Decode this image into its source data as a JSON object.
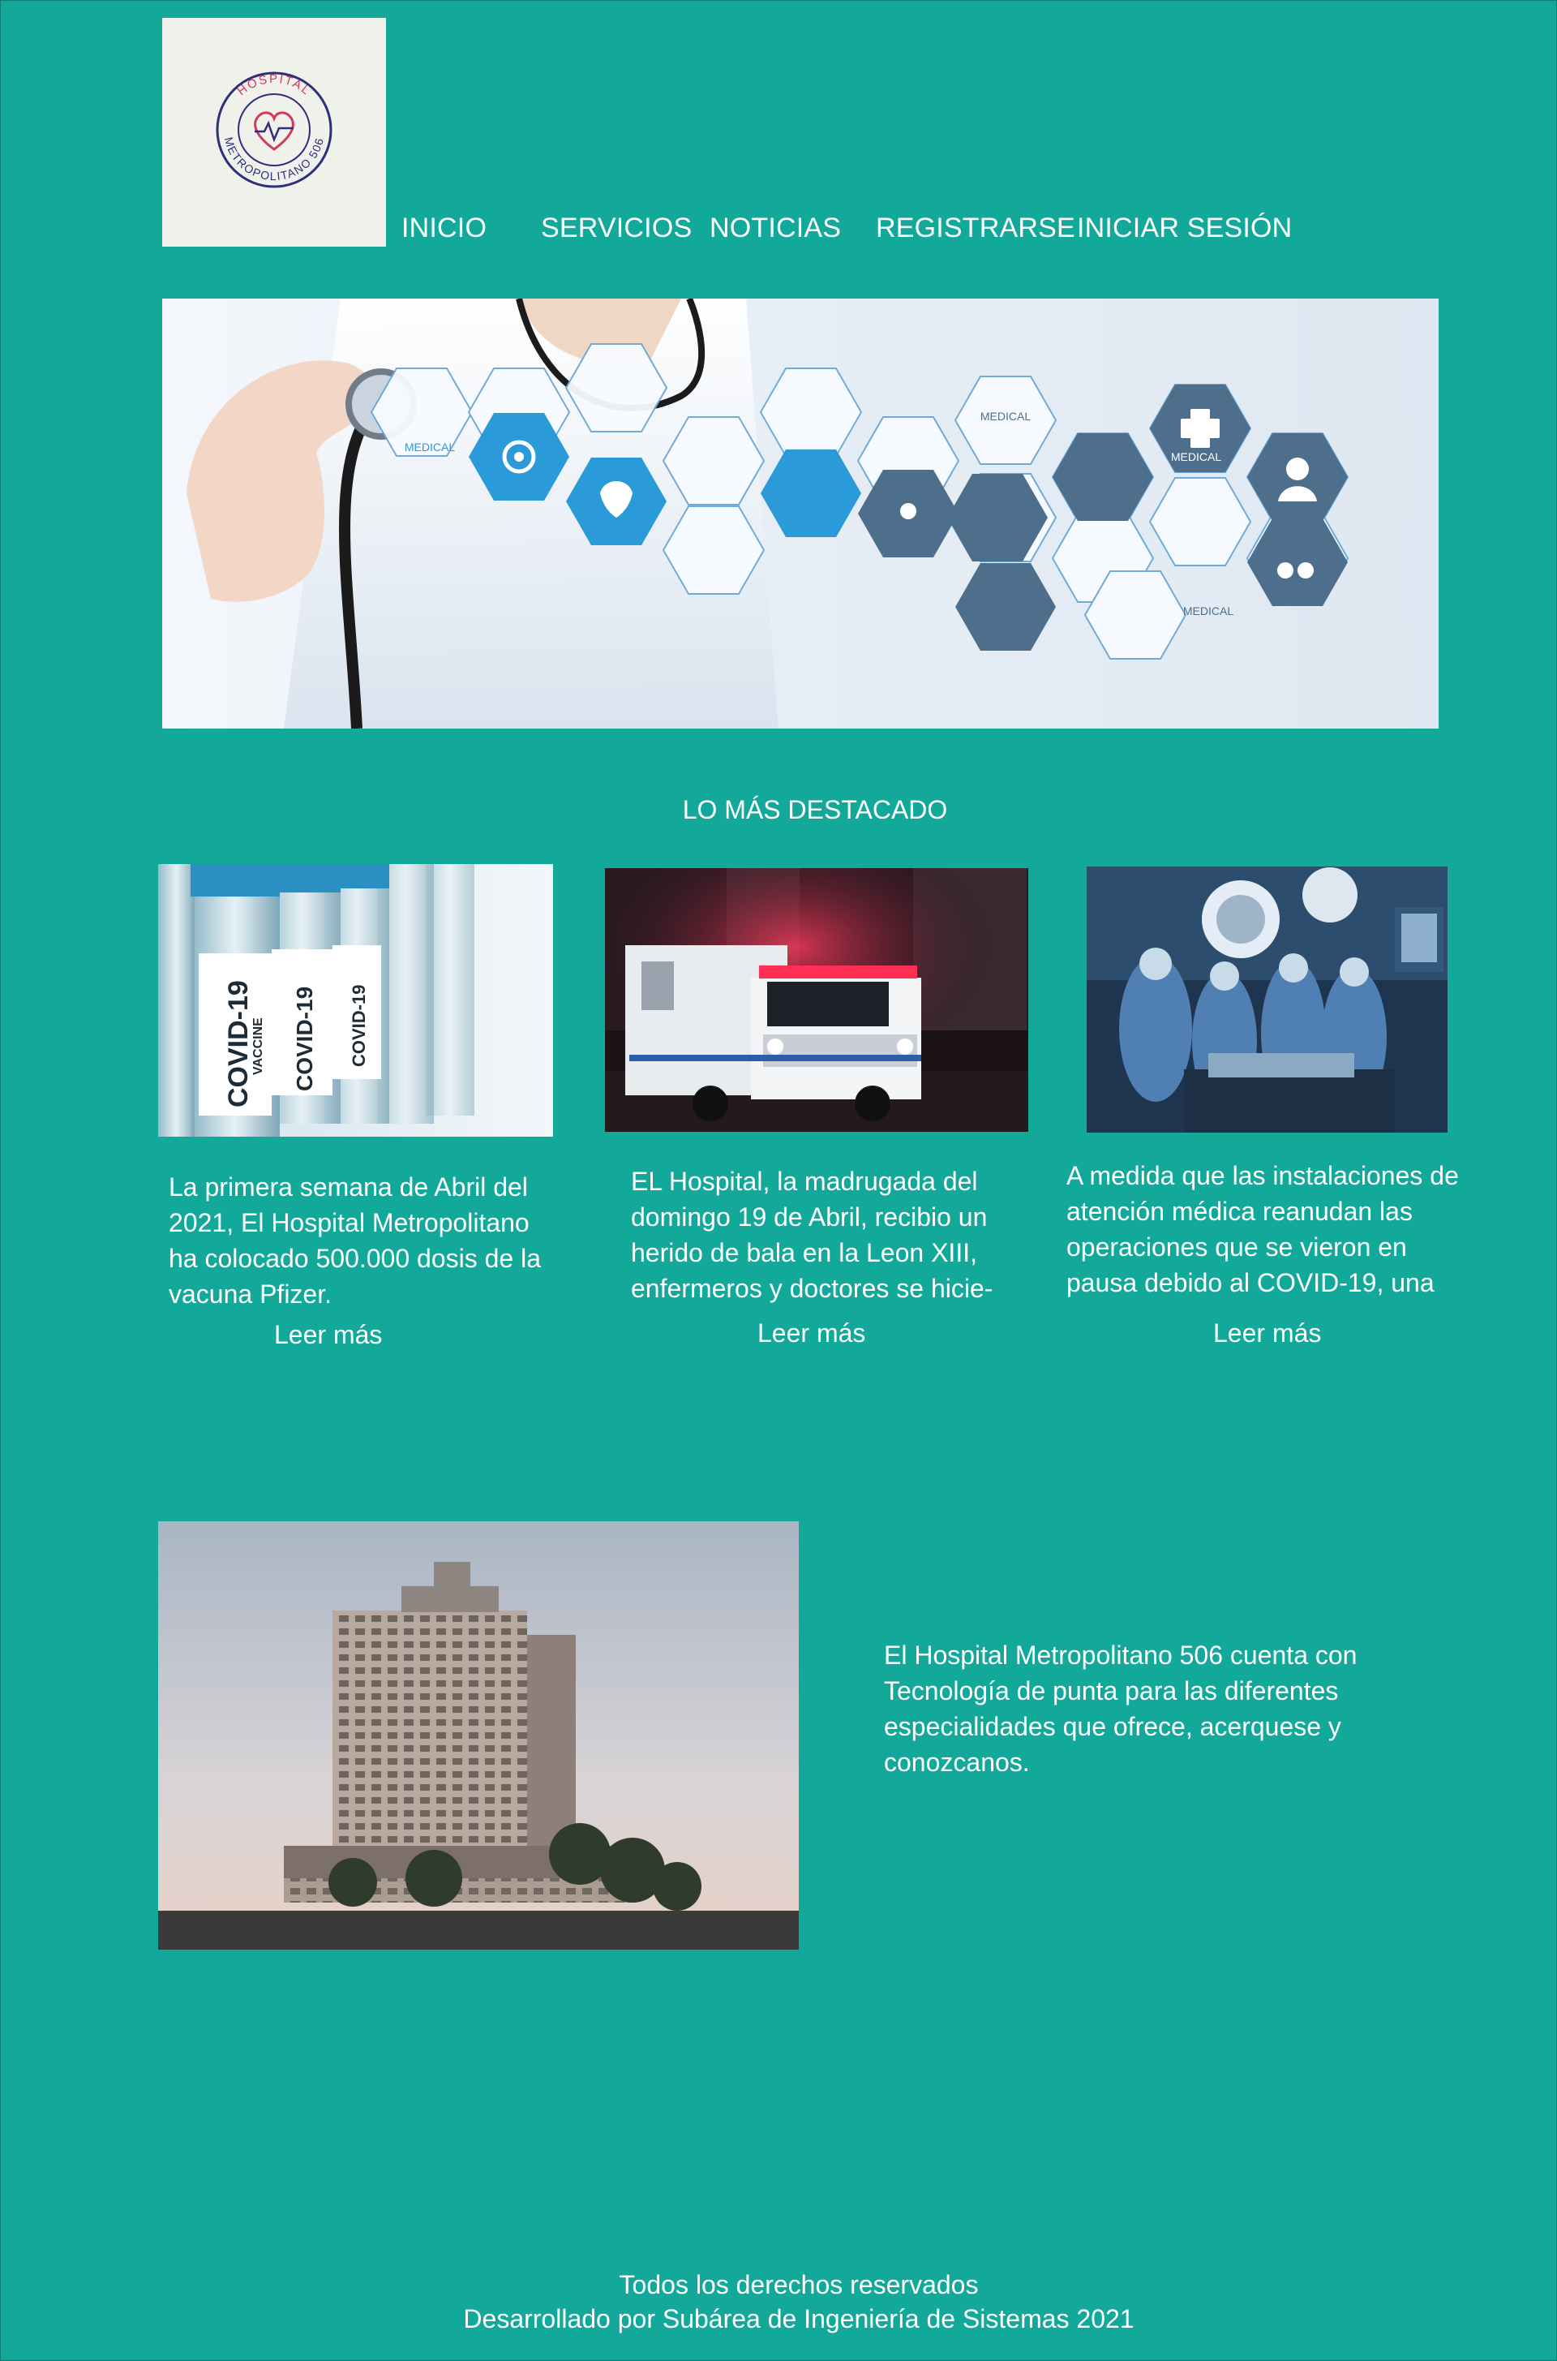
{
  "logo": {
    "top_text": "HOSPITAL",
    "bottom_text": "METROPOLITANO 506"
  },
  "nav": {
    "items": [
      "INICIO",
      "SERVICIOS",
      "NOTICIAS",
      "REGISTRARSE",
      "INICIAR SESIÓN"
    ]
  },
  "hero": {
    "badge_labels": [
      "MEDICAL",
      "MEDICAL",
      "MEDICAL",
      "MEDICAL"
    ]
  },
  "highlights": {
    "title": "LO MÁS DESTACADO",
    "cards": [
      {
        "image_label": "COVID-19",
        "image_sublabel": "VACCINE",
        "text": "La primera semana de Abril del 2021, El Hospital Metropolitano ha colocado 500.000 dosis de la vacuna Pfizer.",
        "link": "Leer más"
      },
      {
        "text": "EL Hospital, la madrugada del domingo 19 de Abril, recibio un herido de bala en la Leon XIII, enfermeros y doctores se hicie-",
        "link": "Leer más"
      },
      {
        "text": "A medida que las instalaciones de atención médica reanudan las operaciones que se vieron en pausa debido al COVID-19, una",
        "link": "Leer más"
      }
    ]
  },
  "about": {
    "text": "El Hospital Metropolitano 506 cuenta con Tecnología de punta para las diferentes especialidades que ofrece, acerquese y conozcanos."
  },
  "footer": {
    "line1": "Todos los derechos reservados",
    "line2": "Desarrollado por Subárea de Ingeniería de Sistemas 2021"
  },
  "colors": {
    "background": "#12a99b",
    "logo_bg": "#f1f1ec",
    "logo_ring": "#2e2f7a",
    "logo_accent": "#d23a5c"
  }
}
